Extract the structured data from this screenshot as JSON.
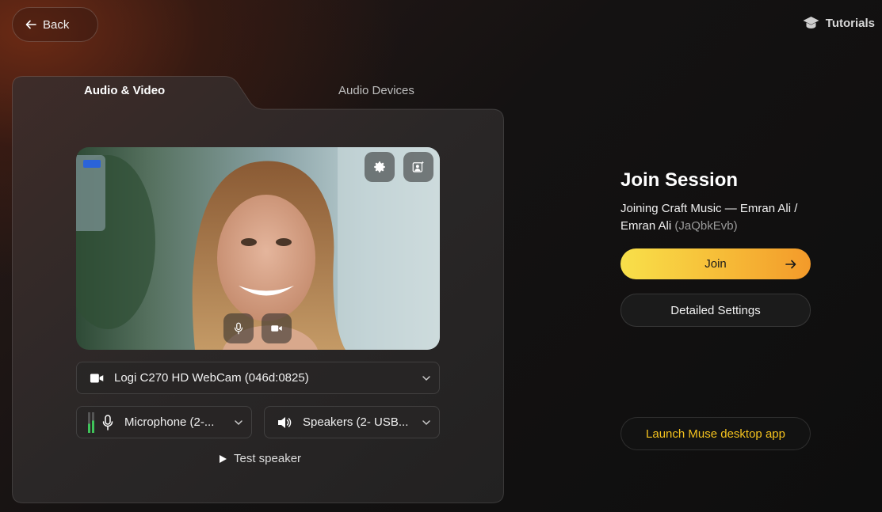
{
  "header": {
    "back_label": "Back",
    "tutorials_label": "Tutorials"
  },
  "tabs": [
    {
      "label": "Audio & Video",
      "active": true
    },
    {
      "label": "Audio Devices",
      "active": false
    }
  ],
  "video": {
    "settings_icon": "gear-icon",
    "effects_icon": "person-sparkle-icon",
    "mic_icon": "microphone-icon",
    "camera_icon": "video-camera-icon"
  },
  "devices": {
    "camera": "Logi C270 HD WebCam (046d:0825)",
    "microphone": "Microphone (2-...",
    "speakers": "Speakers (2- USB...",
    "test_speaker": "Test speaker"
  },
  "join": {
    "title": "Join Session",
    "subtitle": "Joining Craft Music — Emran Ali / Emran Ali",
    "code": "(JaQbkEvb)",
    "join_label": "Join",
    "detailed_settings_label": "Detailed Settings",
    "launch_label": "Launch Muse desktop app"
  },
  "colors": {
    "accent_yellow": "#f8e04a",
    "accent_orange": "#f39a2a",
    "launch_text": "#f4c21e",
    "mic_level_green": "#3fc35a"
  }
}
